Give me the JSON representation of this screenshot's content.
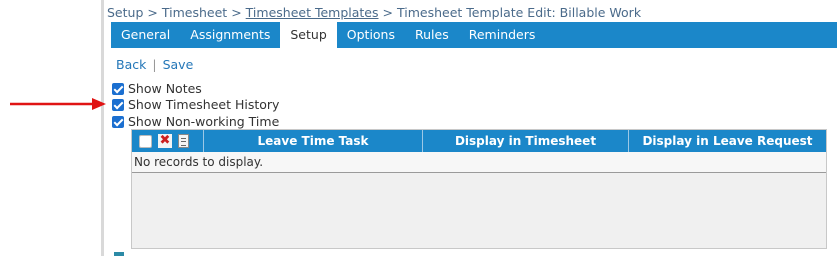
{
  "breadcrumb": {
    "setup": "Setup",
    "sep1": ">",
    "timesheet": "Timesheet",
    "sep2": ">",
    "templates": "Timesheet Templates",
    "sep3": ">",
    "current": "Timesheet Template Edit: Billable Work"
  },
  "tabs": [
    {
      "label": "General"
    },
    {
      "label": "Assignments"
    },
    {
      "label": "Setup"
    },
    {
      "label": "Options"
    },
    {
      "label": "Rules"
    },
    {
      "label": "Reminders"
    }
  ],
  "active_tab": "Setup",
  "actions": {
    "back": "Back",
    "separator": "|",
    "save": "Save"
  },
  "options": [
    {
      "label": "Show Notes",
      "checked": true
    },
    {
      "label": "Show Timesheet History",
      "checked": true
    },
    {
      "label": "Show Non-working Time",
      "checked": true
    }
  ],
  "grid": {
    "columns": [
      "Leave Time Task",
      "Display in Timesheet",
      "Display in Leave Request"
    ],
    "empty_message": "No records to display."
  },
  "colors": {
    "accent": "#1b87c9",
    "checkbox": "#1b6fd0",
    "arrow": "#e01414",
    "delete_icon": "#cc1f1f"
  },
  "icons": {
    "select_all": "checkbox-icon",
    "delete": "delete-x-icon",
    "columns": "document-icon",
    "pointer": "red-arrow-icon"
  }
}
